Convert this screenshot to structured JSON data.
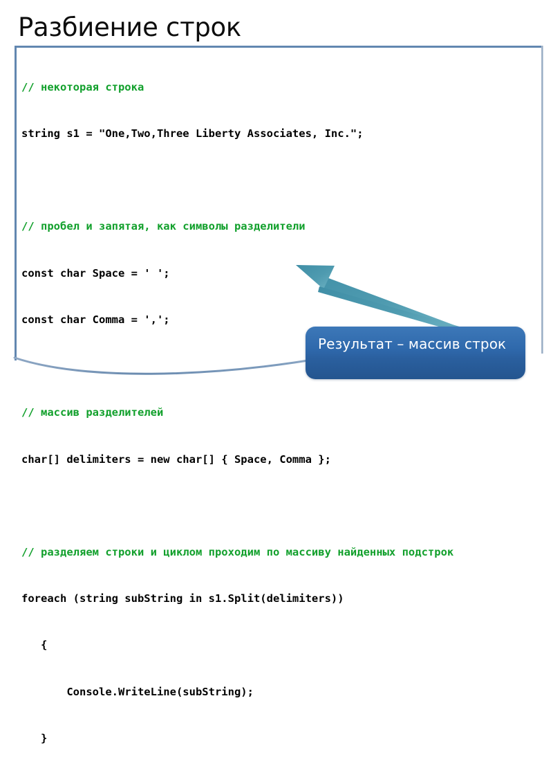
{
  "slide": {
    "title": "Разбиение строк",
    "background_color": "#ffffff"
  },
  "code_panel": {
    "border_color": "#6287b0",
    "background_color": "#ffffff",
    "language": "csharp",
    "comment_color": "#12a02c",
    "text_color": "#000000",
    "lines": [
      {
        "type": "comment",
        "text": "// некоторая строка"
      },
      {
        "type": "code",
        "text": "string s1 = \"One,Two,Three Liberty Associates, Inc.\";"
      },
      {
        "type": "blank",
        "text": ""
      },
      {
        "type": "comment",
        "text": "// пробел и запятая, как символы разделители"
      },
      {
        "type": "code",
        "text": "const char Space = ' ';"
      },
      {
        "type": "code",
        "text": "const char Comma = ',';"
      },
      {
        "type": "blank",
        "text": ""
      },
      {
        "type": "comment",
        "text": "// массив разделителей"
      },
      {
        "type": "code",
        "text": "char[] delimiters = new char[] { Space, Comma };"
      },
      {
        "type": "blank",
        "text": ""
      },
      {
        "type": "comment",
        "text": "// разделяем строки и циклом проходим по массиву найденных подстрок"
      },
      {
        "type": "code",
        "text": "foreach (string subString in s1.Split(delimiters))"
      },
      {
        "type": "code",
        "text": "   {"
      },
      {
        "type": "code",
        "text": "       Console.WriteLine(subString);"
      },
      {
        "type": "code",
        "text": "   }"
      }
    ]
  },
  "callout": {
    "text": "Результат – массив строк",
    "fill_color": "#2f69ac",
    "text_color": "#ffffff",
    "arrow_color": "#4c93a8"
  }
}
